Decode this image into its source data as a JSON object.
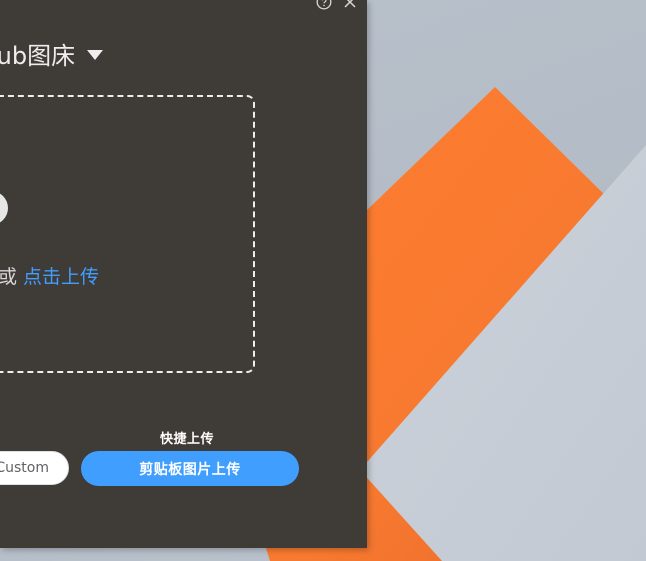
{
  "window": {
    "title": "lub图床",
    "help_icon": "question-circle-icon",
    "close_icon": "close-icon"
  },
  "upload_area": {
    "icon": "upload-cloud-icon",
    "or_text": "或",
    "click_upload_link": "点击上传"
  },
  "quick_upload": {
    "label": "快捷上传",
    "custom_button": "Custom",
    "clipboard_button": "剪贴板图片上传"
  },
  "colors": {
    "panel_bg": "#3f3b36",
    "accent_blue": "#409eff",
    "wallpaper_orange": "#fb7a2e",
    "wallpaper_gray": "#c6ccd6"
  }
}
